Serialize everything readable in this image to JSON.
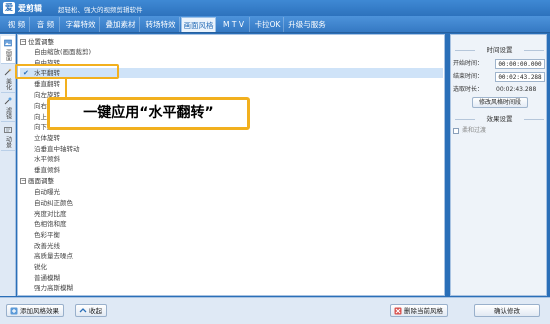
{
  "titlebar": {
    "app_name": "爱剪辑",
    "slogan": "超轻松、强大的视频剪辑软件",
    "logo_glyph": "爱"
  },
  "menu": [
    {
      "label": "视  频",
      "active": false
    },
    {
      "label": "音  频",
      "active": false
    },
    {
      "label": "字幕特效",
      "active": false
    },
    {
      "label": "叠加素材",
      "active": false
    },
    {
      "label": "转场特效",
      "active": false
    },
    {
      "label": "画面风格",
      "active": true
    },
    {
      "label": "M T V",
      "active": false
    },
    {
      "label": "卡拉OK",
      "active": false
    },
    {
      "label": "升级与服务",
      "active": false
    }
  ],
  "left_tabs": [
    {
      "label": "画面",
      "icon": "picture-icon"
    },
    {
      "label": "美化",
      "icon": "wand-icon"
    },
    {
      "label": "滤镜",
      "icon": "filter-icon"
    },
    {
      "label": "动景",
      "icon": "motion-icon"
    }
  ],
  "groups": [
    {
      "label": "位置调整",
      "items": [
        "自由缩放(画面裁剪)",
        "自由旋转",
        "水平翻转",
        "垂直翻转",
        "向左旋转",
        "向右旋转",
        "向上旋转",
        "向下旋转",
        "立体旋转",
        "沿垂直中轴转动",
        "水平倾斜",
        "垂直倾斜"
      ],
      "selected_index": 2
    },
    {
      "label": "画面调整",
      "items": [
        "自动曝光",
        "自动纠正颜色",
        "亮度对比度",
        "色相饱和度",
        "色彩平衡",
        "改善光线",
        "高质量去噪点",
        "锐化",
        "普通模糊",
        "强力高斯模糊"
      ],
      "selected_index": -1
    }
  ],
  "callout": {
    "text": "一键应用“水平翻转”",
    "accent": "#f2b01e"
  },
  "time_settings": {
    "section_title": "时间设置",
    "start_label": "开始时间：",
    "start_value": "00:00:00.000",
    "end_label": "结束时间：",
    "end_value": "00:02:43.288",
    "selected_label": "选取时长：",
    "selected_value": "00:02:43.288",
    "modify_button": "修改风格时间段"
  },
  "effect_settings": {
    "section_title": "效果设置",
    "soft_transition": "柔和过渡",
    "soft_transition_checked": false
  },
  "bottom": {
    "add_button": "添加风格效果",
    "collect_button": "收起",
    "delete_button": "删除当前风格",
    "confirm_button": "确认修改"
  },
  "colors": {
    "accent_blue": "#2a6fb8",
    "selected_row": "#cfe3f8",
    "highlight": "#f2b01e"
  }
}
